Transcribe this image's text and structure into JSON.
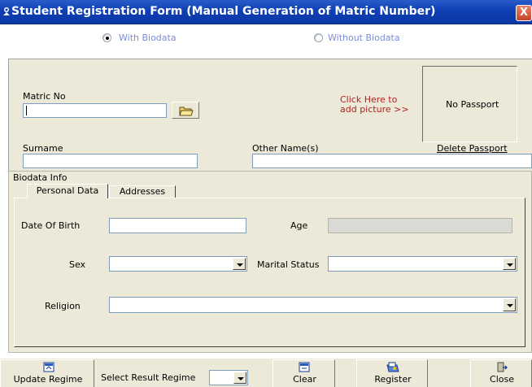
{
  "window": {
    "title": "Student Registration Form (Manual Generation of Matric Number)",
    "close_glyph": "X"
  },
  "mode": {
    "options": [
      {
        "label": "With Biodata",
        "selected": true
      },
      {
        "label": "Without Biodata",
        "selected": false
      }
    ]
  },
  "form": {
    "matric_label": "Matric No",
    "matric_value": "",
    "add_picture_text_1": "Click Here to",
    "add_picture_text_2": "add picture >>",
    "passport_placeholder": "No Passport",
    "delete_passport_label": "Delete Passport",
    "surname_label": "Surname",
    "surname_value": "",
    "other_names_label": "Other Name(s)",
    "other_names_value": ""
  },
  "biodata": {
    "group_label": "Biodata Info",
    "tabs": [
      {
        "label": "Personal Data",
        "active": true
      },
      {
        "label": "Addresses",
        "active": false
      }
    ],
    "dob_label": "Date Of Birth",
    "dob_value": "",
    "age_label": "Age",
    "age_value": "",
    "sex_label": "Sex",
    "sex_value": "",
    "marital_label": "Marital Status",
    "marital_value": "",
    "religion_label": "Religion",
    "religion_value": ""
  },
  "toolbar": {
    "update_regime_label": "Update Regime",
    "select_regime_label": "Select Result Regime",
    "select_regime_value": "",
    "clear_label": "Clear",
    "register_label": "Register",
    "close_label": "Close"
  },
  "icons": {
    "app": "app-icon",
    "folder": "open-folder-icon",
    "update": "update-icon",
    "clear": "clear-icon",
    "register": "register-icon",
    "close": "close-icon"
  },
  "colors": {
    "titlebar": "#0f3fb4",
    "add_picture_text": "#b22222",
    "radio_label": "#7c8cd8",
    "panel": "#ece9d8"
  }
}
